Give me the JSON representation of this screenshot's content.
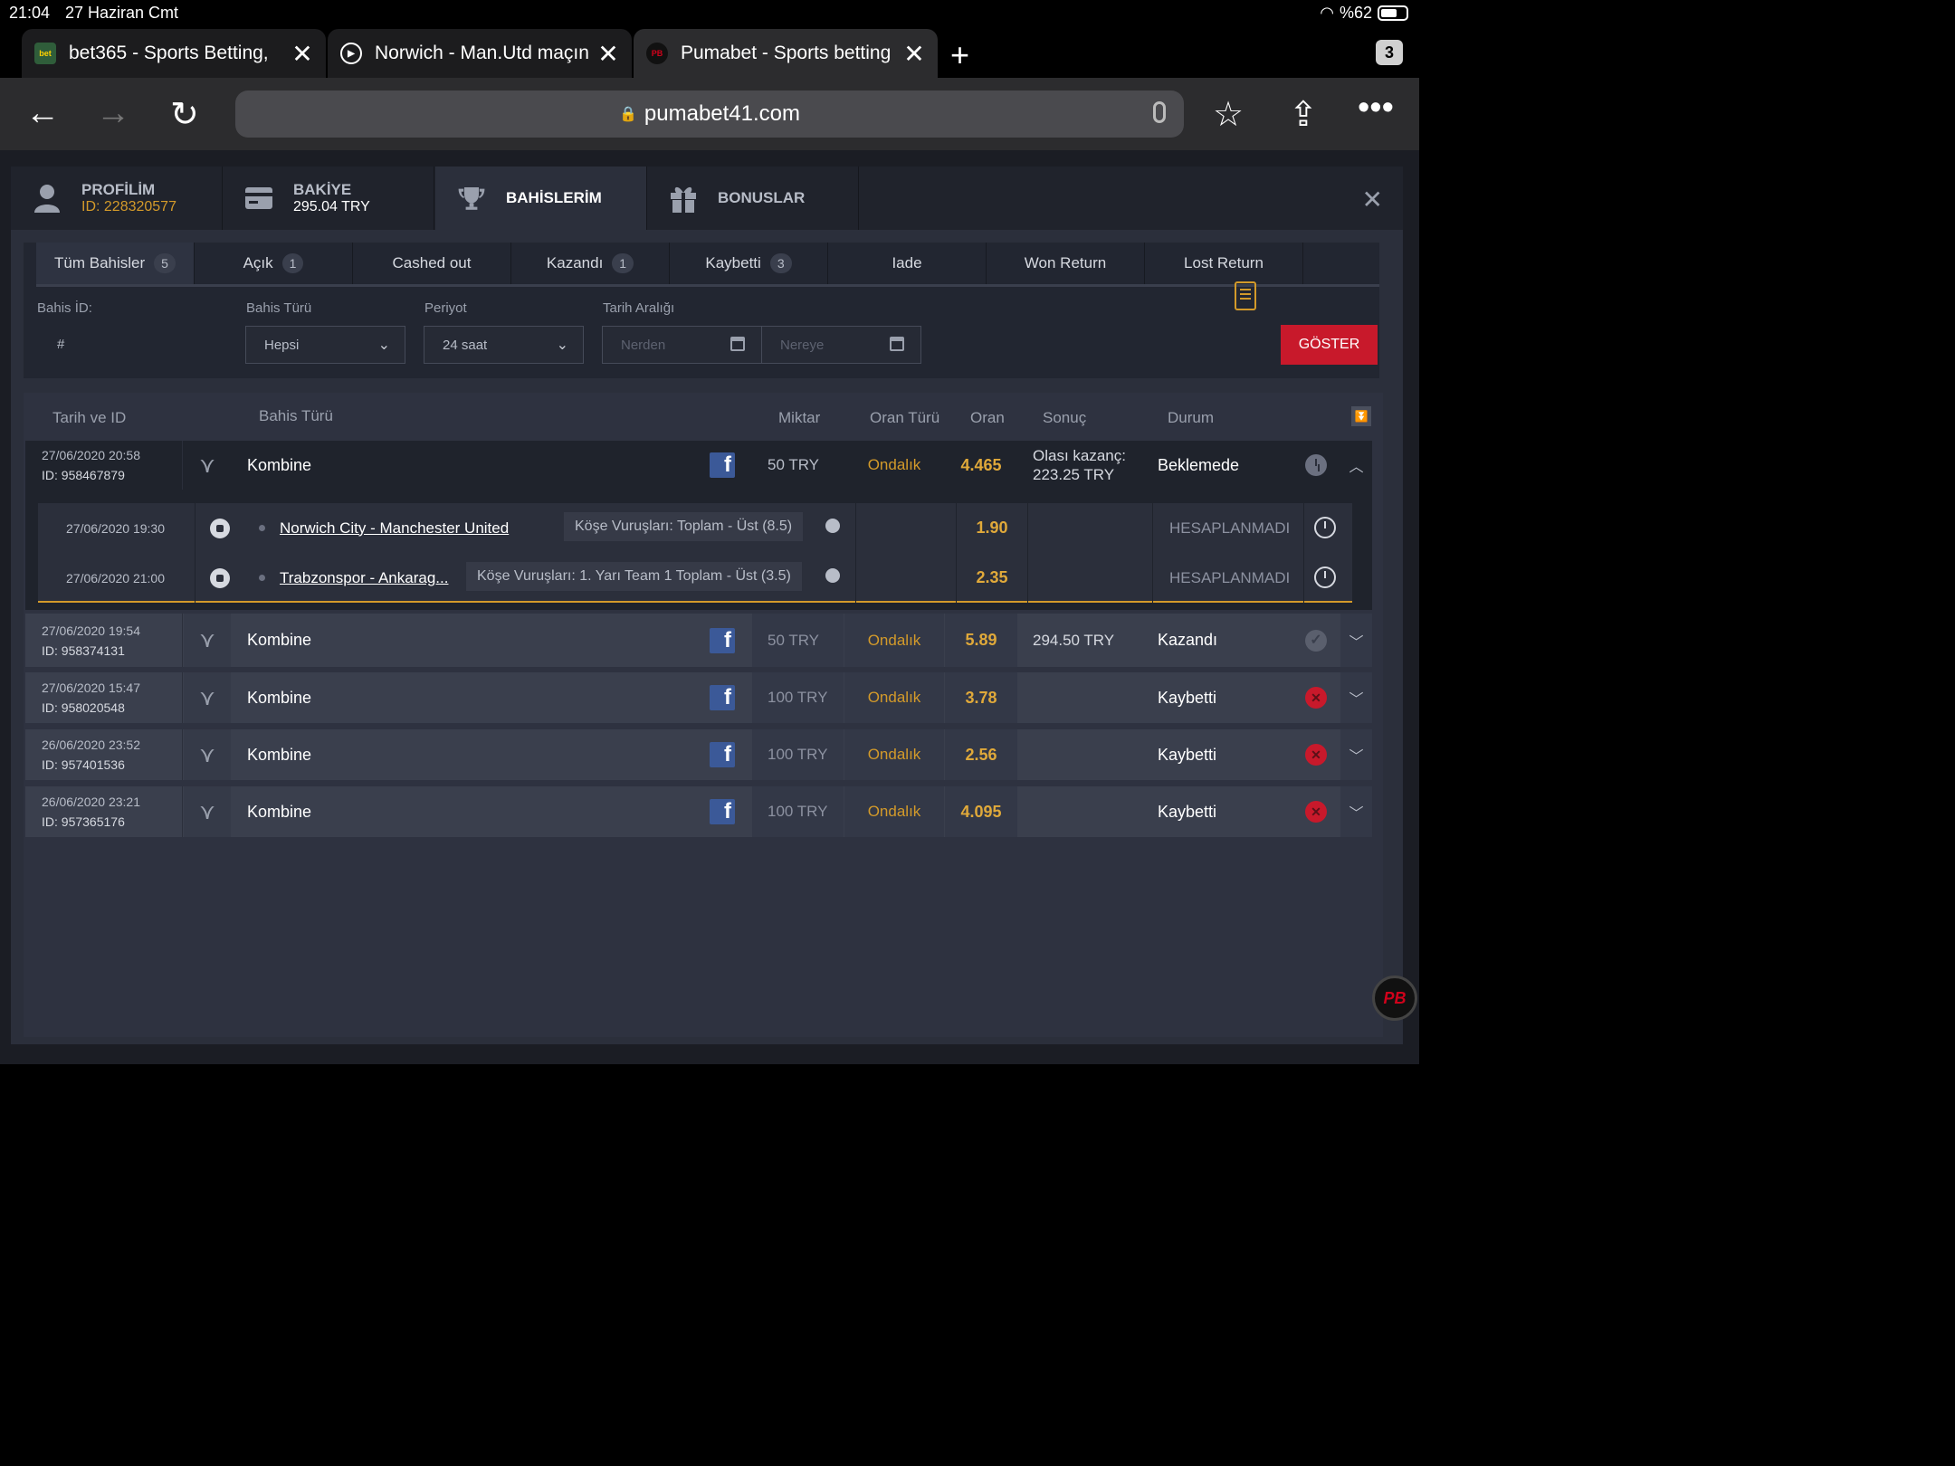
{
  "status": {
    "time": "21:04",
    "date": "27 Haziran Cmt",
    "battery": "%62"
  },
  "browser": {
    "tabs": [
      {
        "title": "bet365 - Sports Betting,",
        "favicon": "bet365"
      },
      {
        "title": "Norwich - Man.Utd maçın",
        "favicon": "play"
      },
      {
        "title": "Pumabet - Sports betting",
        "favicon": "PB"
      }
    ],
    "tab_count": "3",
    "url": "pumabet41.com"
  },
  "nav": {
    "profile": {
      "label": "PROFİLİM",
      "id": "ID: 228320577"
    },
    "balance": {
      "label": "BAKİYE",
      "value": "295.04 TRY"
    },
    "bets": {
      "label": "BAHİSLERİM"
    },
    "bonus": {
      "label": "BONUSLAR"
    }
  },
  "filters": {
    "tabs": [
      {
        "label": "Tüm Bahisler",
        "count": "5"
      },
      {
        "label": "Açık",
        "count": "1"
      },
      {
        "label": "Cashed out",
        "count": ""
      },
      {
        "label": "Kazandı",
        "count": "1"
      },
      {
        "label": "Kaybetti",
        "count": "3"
      },
      {
        "label": "Iade",
        "count": ""
      },
      {
        "label": "Won Return",
        "count": ""
      },
      {
        "label": "Lost Return",
        "count": ""
      }
    ],
    "bet_id_label": "Bahis İD:",
    "bet_id_placeholder": "#",
    "bet_type_label": "Bahis Türü",
    "bet_type_value": "Hepsi",
    "period_label": "Periyot",
    "period_value": "24 saat",
    "date_range_label": "Tarih Aralığı",
    "from_placeholder": "Nerden",
    "to_placeholder": "Nereye",
    "show_button": "GÖSTER"
  },
  "table": {
    "headers": {
      "date_id": "Tarih ve ID",
      "bet_type": "Bahis Türü",
      "amount": "Miktar",
      "odds_type": "Oran Türü",
      "odds": "Oran",
      "result": "Sonuç",
      "status": "Durum"
    },
    "rows": [
      {
        "date": "27/06/2020 20:58",
        "id": "ID: 958467879",
        "type": "Kombine",
        "amount": "50 TRY",
        "odds_type": "Ondalık",
        "odds": "4.465",
        "result_label": "Olası kazanç:",
        "result_value": "223.25 TRY",
        "status": "Beklemede"
      },
      {
        "date": "27/06/2020 19:54",
        "id": "ID: 958374131",
        "type": "Kombine",
        "amount": "50 TRY",
        "odds_type": "Ondalık",
        "odds": "5.89",
        "result_label": "",
        "result_value": "294.50 TRY",
        "status": "Kazandı"
      },
      {
        "date": "27/06/2020 15:47",
        "id": "ID: 958020548",
        "type": "Kombine",
        "amount": "100 TRY",
        "odds_type": "Ondalık",
        "odds": "3.78",
        "result_label": "",
        "result_value": "",
        "status": "Kaybetti"
      },
      {
        "date": "26/06/2020 23:52",
        "id": "ID: 957401536",
        "type": "Kombine",
        "amount": "100 TRY",
        "odds_type": "Ondalık",
        "odds": "2.56",
        "result_label": "",
        "result_value": "",
        "status": "Kaybetti"
      },
      {
        "date": "26/06/2020 23:21",
        "id": "ID: 957365176",
        "type": "Kombine",
        "amount": "100 TRY",
        "odds_type": "Ondalık",
        "odds": "4.095",
        "result_label": "",
        "result_value": "",
        "status": "Kaybetti"
      }
    ],
    "selections": [
      {
        "date": "27/06/2020 19:30",
        "match": "Norwich City - Manchester United",
        "market": "Köşe Vuruşları: Toplam - Üst (8.5)",
        "odds": "1.90",
        "status": "HESAPLANMADI"
      },
      {
        "date": "27/06/2020 21:00",
        "match": "Trabzonspor - Ankarag...",
        "market": "Köşe Vuruşları: 1. Yarı Team 1 Toplam - Üst (3.5)",
        "odds": "2.35",
        "status": "HESAPLANMADI"
      }
    ]
  },
  "colors": {
    "accent": "#e0a93a",
    "danger": "#c8192b",
    "facebook": "#3b5998"
  }
}
